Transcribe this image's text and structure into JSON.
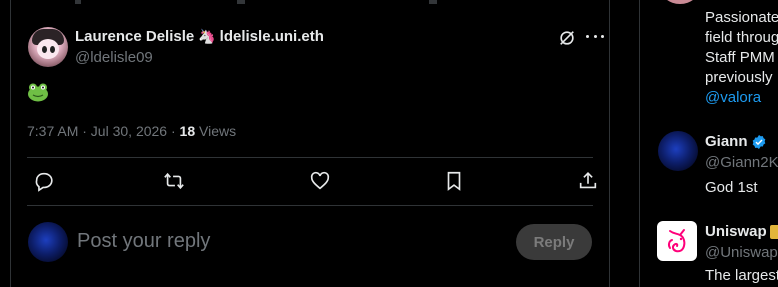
{
  "tweet": {
    "author": {
      "display_name": "Laurence Delisle",
      "name_emoji": "🦄",
      "name_suffix": "ldelisle.uni.eth",
      "handle": "@ldelisle09"
    },
    "emoji": "frog-emoji",
    "timestamp": "7:37 AM · Jul 30, 2026 · ",
    "views_count": "18",
    "views_label": " Views"
  },
  "actions": [
    {
      "name": "reply",
      "icon": "reply-icon"
    },
    {
      "name": "retweet",
      "icon": "retweet-icon"
    },
    {
      "name": "like",
      "icon": "heart-icon"
    },
    {
      "name": "bookmark",
      "icon": "bookmark-icon"
    },
    {
      "name": "share",
      "icon": "share-icon"
    }
  ],
  "composer": {
    "placeholder": "Post your reply",
    "button_label": "Reply"
  },
  "sidebar": {
    "bio_lines": [
      "Passionate",
      "field throug",
      "Staff PMM",
      "previously"
    ],
    "bio_link": "@valora",
    "accounts": [
      {
        "name": "Giann",
        "handle": "@Giann2K",
        "text": "God 1st",
        "verified_color": "#1d9bf0"
      },
      {
        "name": "Uniswap",
        "handle": "@Uniswap",
        "text": "The largest",
        "badge_color": "#e2b43a"
      }
    ]
  },
  "colors": {
    "background": "#000000",
    "text": "#e7e9ea",
    "muted": "#71767b",
    "border": "#2f3336",
    "accent": "#1d9bf0"
  }
}
